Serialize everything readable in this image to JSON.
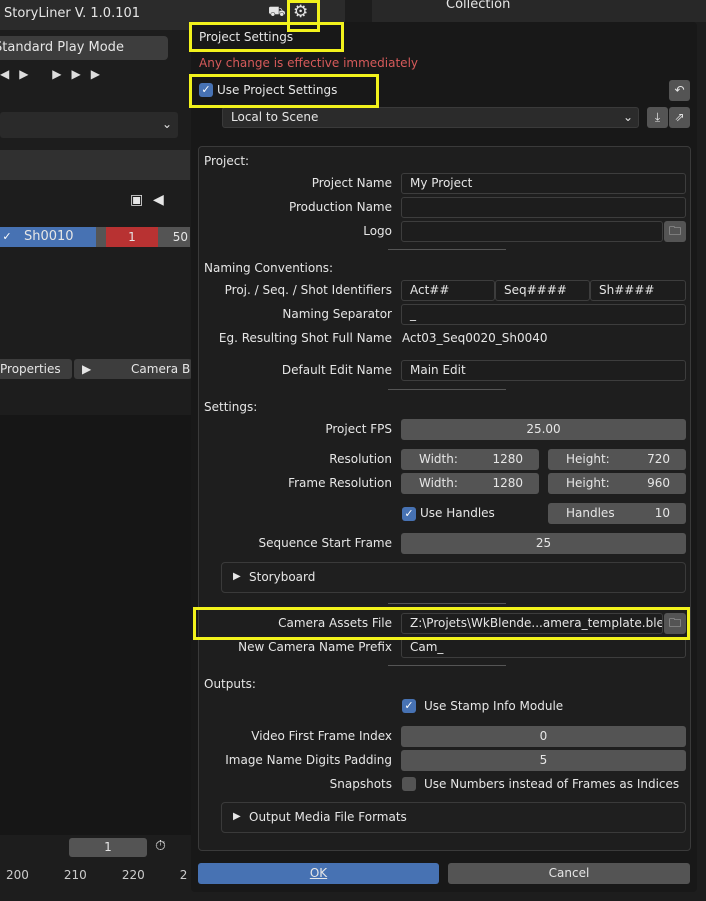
{
  "background": {
    "addon_title": "StoryLiner V. 1.0.101",
    "play_mode": "Standard Play Mode",
    "outliner_collection": "Collection",
    "shot": {
      "name": "Sh0010",
      "start": "1",
      "end": "50"
    },
    "properties_tab": "Properties",
    "camera_tab": "Camera B",
    "frame_field": "1",
    "timeline_ticks": [
      "200",
      "210",
      "220",
      "2"
    ]
  },
  "dialog": {
    "title": "Project Settings",
    "warning": "Any change is effective immediately",
    "use_project_settings": {
      "label": "Use Project Settings",
      "checked": true
    },
    "source_dropdown": "Local to Scene",
    "project": {
      "heading": "Project:",
      "name": {
        "label": "Project Name",
        "value": "My Project"
      },
      "production": {
        "label": "Production Name",
        "value": ""
      },
      "logo": {
        "label": "Logo",
        "value": ""
      }
    },
    "naming": {
      "heading": "Naming Conventions:",
      "identifiers": {
        "label": "Proj. / Seq. / Shot Identifiers",
        "values": [
          "Act##",
          "Seq####",
          "Sh####"
        ]
      },
      "separator": {
        "label": "Naming Separator",
        "value": "_"
      },
      "example": {
        "label": "Eg. Resulting Shot Full Name",
        "value": "Act03_Seq0020_Sh0040"
      },
      "edit_name": {
        "label": "Default Edit Name",
        "value": "Main Edit"
      }
    },
    "settings": {
      "heading": "Settings:",
      "fps": {
        "label": "Project FPS",
        "value": "25.00"
      },
      "resolution": {
        "label": "Resolution",
        "width": "1280",
        "height": "720"
      },
      "frame_resolution": {
        "label": "Frame Resolution",
        "width": "1280",
        "height": "960"
      },
      "width_label": "Width:",
      "height_label": "Height:",
      "use_handles": {
        "label": "Use Handles",
        "checked": true
      },
      "handles": {
        "label": "Handles",
        "value": "10"
      },
      "seq_start": {
        "label": "Sequence Start Frame",
        "value": "25"
      },
      "storyboard": "Storyboard",
      "camera_assets": {
        "label": "Camera Assets File",
        "value": "Z:\\Projets\\WkBlende...amera_template.blend"
      },
      "camera_prefix": {
        "label": "New Camera Name Prefix",
        "value": "Cam_"
      }
    },
    "outputs": {
      "heading": "Outputs:",
      "stamp": {
        "label": "Use Stamp Info Module",
        "checked": true
      },
      "video_first": {
        "label": "Video First Frame Index",
        "value": "0"
      },
      "digits": {
        "label": "Image Name Digits Padding",
        "value": "5"
      },
      "snapshots": {
        "label": "Snapshots",
        "option": "Use Numbers instead of Frames as Indices",
        "checked": false
      },
      "media_formats": "Output Media File Formats"
    },
    "ok": "OK",
    "cancel": "Cancel"
  },
  "colors": {
    "accent": "#4772b3",
    "warning": "#d65a5a",
    "highlight": "#f2f21c",
    "shot_red": "#b83232"
  }
}
